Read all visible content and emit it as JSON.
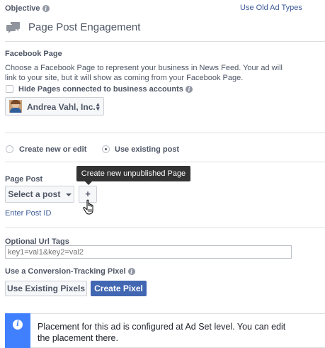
{
  "objective": {
    "label": "Objective",
    "link": "Use Old Ad Types",
    "value": "Page Post Engagement"
  },
  "facebook_page": {
    "label": "Facebook Page",
    "description": "Choose a Facebook Page to represent your business in News Feed. Your ad will link to your site, but it will show as coming from your Facebook Page.",
    "hide_label": "Hide Pages connected to business accounts",
    "selected_page": "Andrea Vahl, Inc."
  },
  "post_mode": {
    "create_label": "Create new or edit",
    "existing_label": "Use existing post",
    "selected": "existing"
  },
  "page_post": {
    "label": "Page Post",
    "select_label": "Select a post",
    "add_label": "+",
    "tooltip": "Create new unpublished Page post",
    "enter_id_link": "Enter Post ID"
  },
  "url_tags": {
    "label": "Optional Url Tags",
    "placeholder": "key1=val1&key2=val2"
  },
  "pixel": {
    "label": "Use a Conversion-Tracking Pixel",
    "existing_button": "Use Existing Pixels",
    "create_button": "Create Pixel"
  },
  "notice": {
    "text": "Placement for this ad is configured at Ad Set level. You can edit the placement there."
  },
  "colors": {
    "primary_button": "#4267b2",
    "notice_bar": "#4080ff",
    "tooltip_bg": "#333333",
    "link": "#3b5998"
  }
}
